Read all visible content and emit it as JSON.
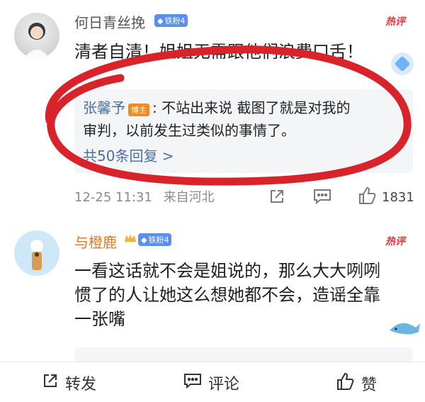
{
  "comment1": {
    "username": "何日青丝挽",
    "fan_badge": "铁粉4",
    "hot_label": "热评",
    "content": "清者自清！姐姐无需跟他们浪费口舌！",
    "reply": {
      "author": "张馨予",
      "author_tag": "博主",
      "text_line1": ": 不站出来说 截图了就是对我的",
      "text_line2": "审判，以前发生过类似的事情了。",
      "more": "共50条回复 >"
    },
    "time": "12-25 11:31",
    "location": "来自河北",
    "likes": "1831"
  },
  "comment2": {
    "username": "与橙鹿",
    "fan_badge": "铁粉4",
    "hot_label": "热评",
    "content_line1": "一看这话就不会是姐说的，那么大大咧咧",
    "content_line2": "惯了的人让她这么想她都不会，造谣全靠",
    "content_line3": "一张嘴"
  },
  "bottom_bar": {
    "repost_label": "转发",
    "comment_label": "评论",
    "like_label": "赞"
  },
  "colors": {
    "accent_orange": "#e07a1f",
    "hot_red": "#e8383d",
    "badge_blue": "#5b8ef0",
    "annotation_red": "#d9232b"
  }
}
